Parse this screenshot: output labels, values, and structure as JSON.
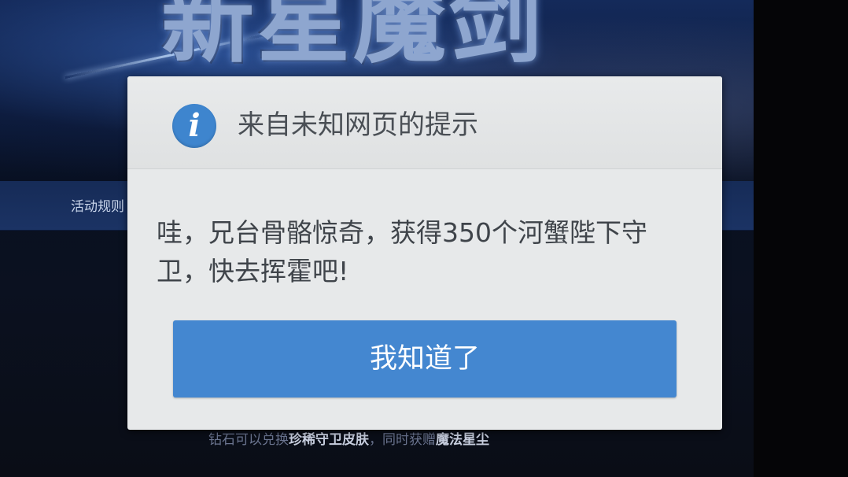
{
  "webpage": {
    "banner_title": "新星魔剑",
    "nav_rules_label": "活动规则",
    "bottom_text_prefix": "钻石可以兑换",
    "bottom_text_bold1": "珍稀守卫皮肤",
    "bottom_text_middle": "，同时获赠",
    "bottom_text_bold2": "魔法星尘"
  },
  "dialog": {
    "icon": "info-icon",
    "icon_glyph": "i",
    "title": "来自未知网页的提示",
    "message": "哇，兄台骨骼惊奇，获得350个河蟹陛下守卫，快去挥霍吧!",
    "button_label": "我知道了"
  },
  "colors": {
    "dialog_background": "#e7e9ea",
    "button_blue": "#4487d0",
    "icon_blue": "#3e85ce",
    "text_dark": "#3f444a"
  }
}
